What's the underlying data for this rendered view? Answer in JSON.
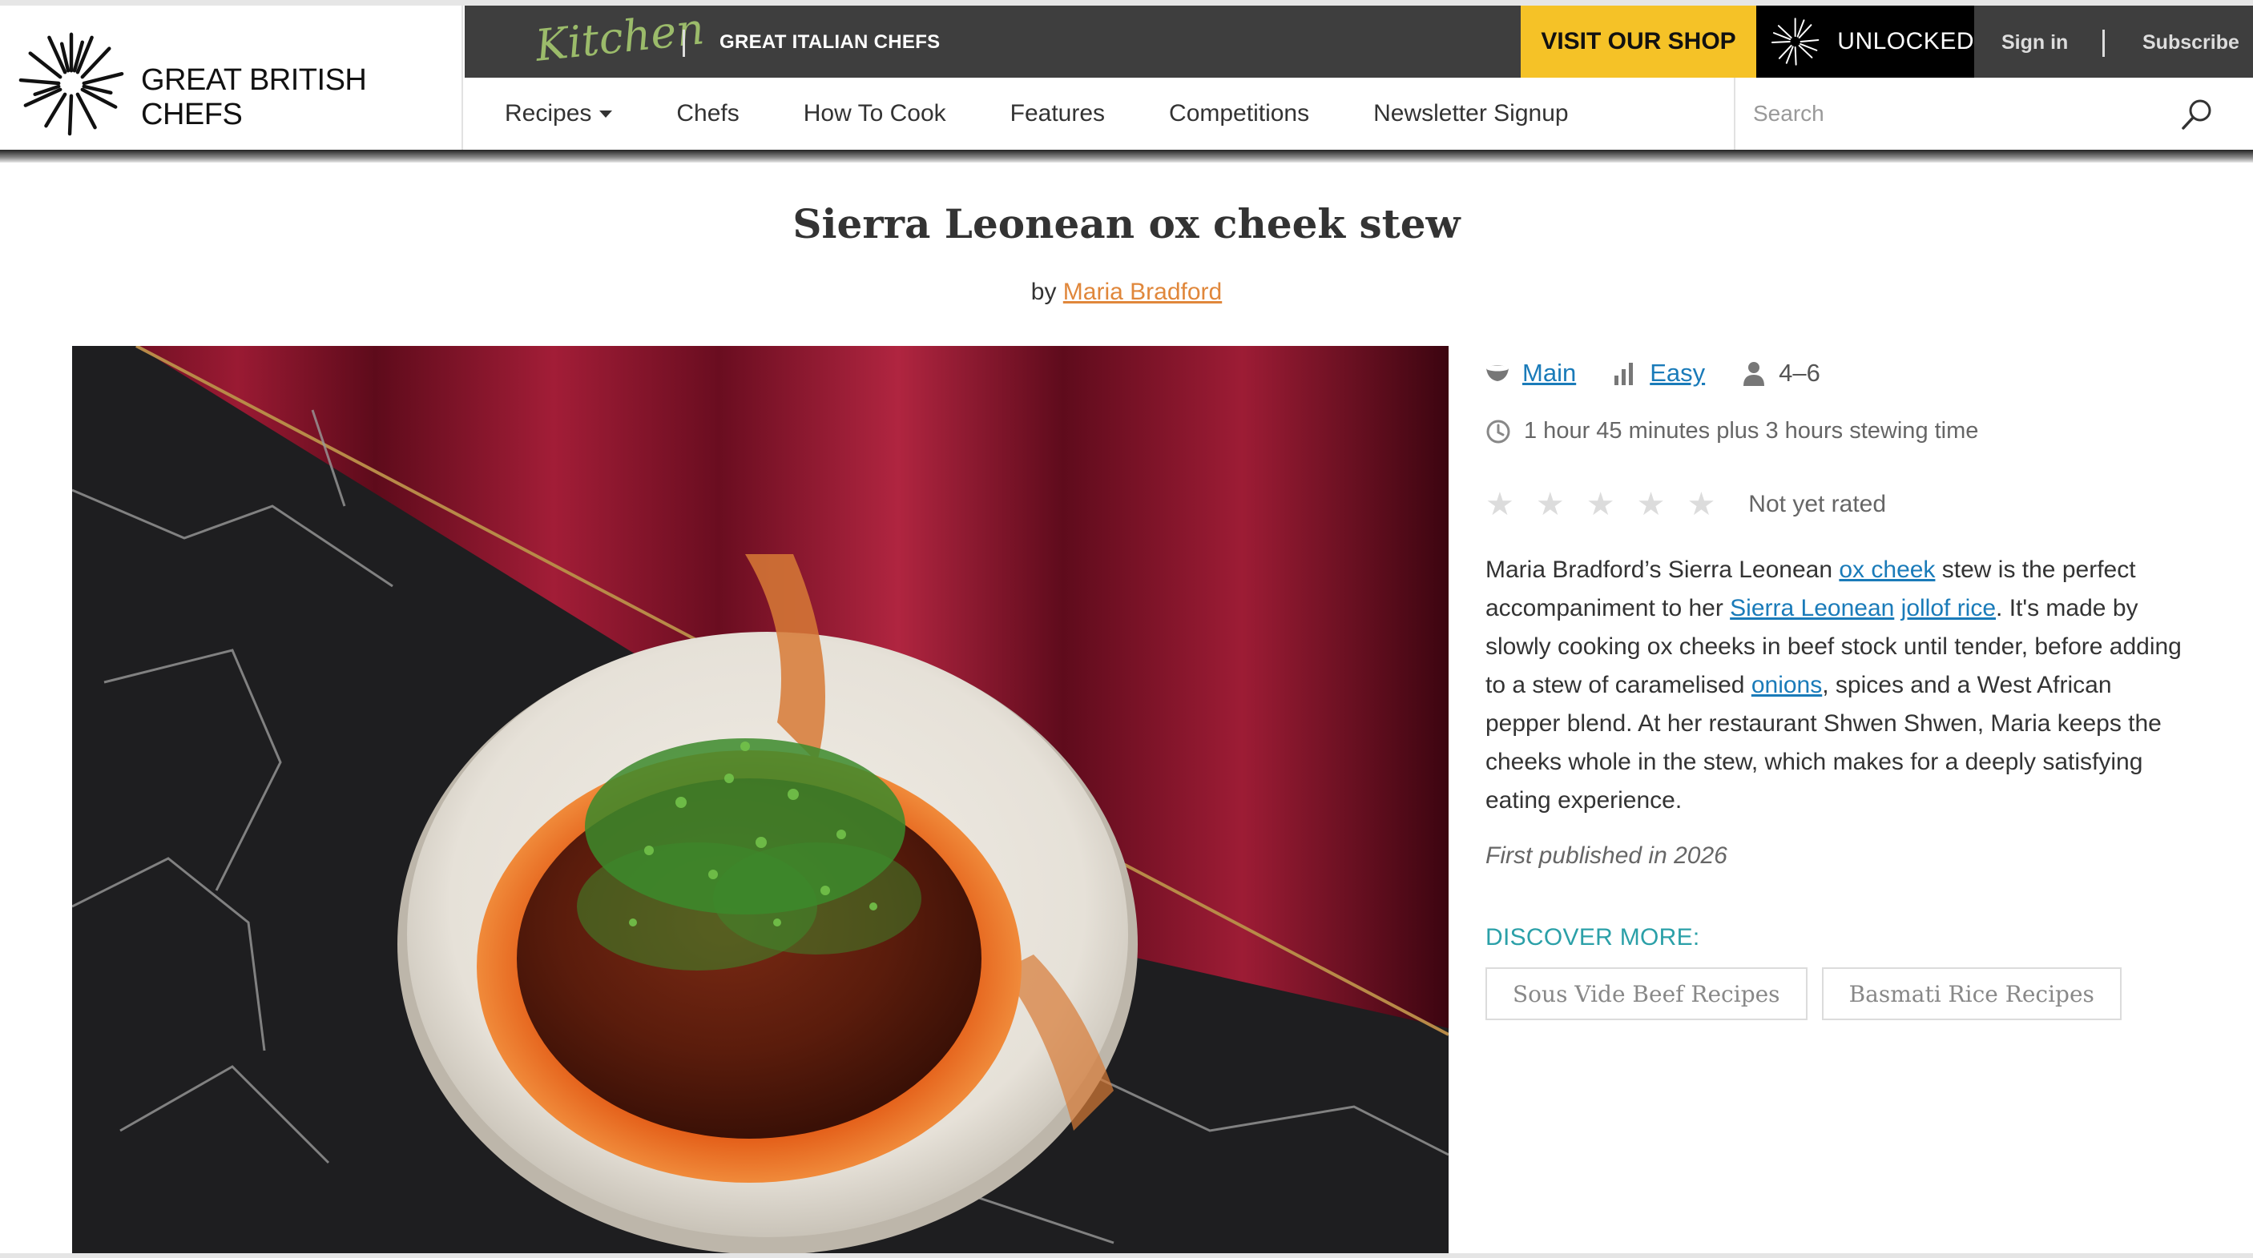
{
  "header": {
    "brand_name": "GREAT BRITISH CHEFS",
    "kitchen_label": "Kitchen",
    "italian_chefs": "GREAT ITALIAN CHEFS",
    "shop_button": "VISIT OUR SHOP",
    "unlocked_label": "UNLOCKED",
    "sign_in": "Sign in",
    "subscribe": "Subscribe",
    "nav": [
      "Recipes",
      "Chefs",
      "How To Cook",
      "Features",
      "Competitions",
      "Newsletter Signup"
    ],
    "search_placeholder": "Search"
  },
  "recipe": {
    "title": "Sierra Leonean ox cheek stew",
    "by": "by",
    "author": "Maria Bradford",
    "course": "Main",
    "difficulty": "Easy",
    "serves": "4–6",
    "time": "1 hour 45 minutes plus 3 hours stewing time",
    "rating_label": "Not yet rated",
    "rating_value": 0,
    "rating_max": 5,
    "desc": {
      "p1": "Maria Bradford’s Sierra Leonean ",
      "link1": "ox cheek",
      "p2": " stew is the perfect accompaniment to her ",
      "link2a": "Sierra Leonean",
      "p3": " ",
      "link2b": "jollof rice",
      "p4": ". It's made by slowly cooking ox cheeks in beef stock until tender, before adding to a stew of caramelised ",
      "link3": "onions",
      "p5": ", spices and a West African pepper blend. At her restaurant Shwen Shwen, Maria keeps the cheeks whole in the stew, which makes for a deeply satisfying eating experience."
    },
    "published": "First published in 2026",
    "discover_label": "DISCOVER MORE:",
    "tags": [
      "Sous Vide Beef Recipes",
      "Basmati Rice Recipes"
    ]
  },
  "colors": {
    "accent_link": "#1a7bb9",
    "author_link": "#e0873b",
    "shop_yellow": "#f5c227",
    "discover_teal": "#2ba0a8",
    "topbar_grey": "#3e3e3e"
  }
}
